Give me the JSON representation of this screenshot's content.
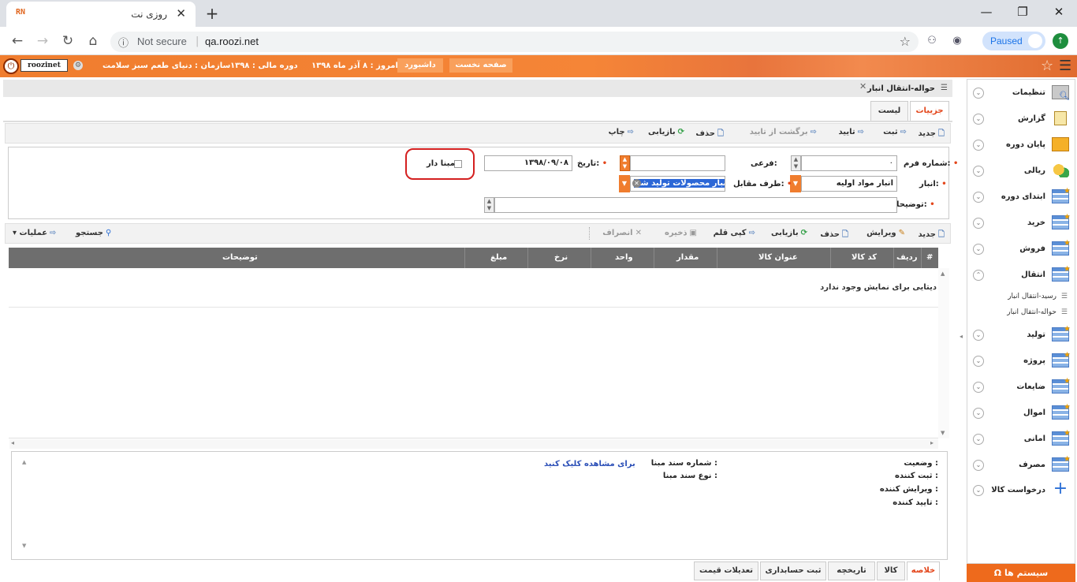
{
  "browser": {
    "tab_title": "روزی نت",
    "favicon": "RN",
    "new_tab": "+",
    "not_secure": "Not secure",
    "url": "qa.roozi.net",
    "paused": "Paused"
  },
  "header": {
    "user": "roozinet",
    "org": "سازمان : دنیای طعم سبز سلامت",
    "fiscal_year": "دوره مالی : ۱۳۹۸",
    "today": "امروز : ۸ آذر ماه ۱۳۹۸",
    "dashboard": "داشبورد",
    "home": "صفحه نخست"
  },
  "sidebar": {
    "items": [
      {
        "label": "تنظیمات"
      },
      {
        "label": "گزارش"
      },
      {
        "label": "پایان دوره"
      },
      {
        "label": "ریالی"
      },
      {
        "label": "ابتدای دوره"
      },
      {
        "label": "خرید"
      },
      {
        "label": "فروش"
      },
      {
        "label": "انتقال"
      },
      {
        "label": "تولید"
      },
      {
        "label": "پروژه"
      },
      {
        "label": "ضایعات"
      },
      {
        "label": "اموال"
      },
      {
        "label": "امانی"
      },
      {
        "label": "مصرف"
      },
      {
        "label": "درخواست کالا"
      }
    ],
    "subitems": [
      {
        "label": "رسید-انتقال انبار"
      },
      {
        "label": "حواله-انتقال انبار"
      }
    ],
    "system_button": "سیستم ها"
  },
  "panel": {
    "title": "حواله-انتقال انبار",
    "tabs": {
      "details": "جزییات",
      "list": "لیست"
    }
  },
  "toolbar": {
    "new": "جدید",
    "register": "ثبت",
    "approve": "تایید",
    "unapprove": "برگشت از تایید",
    "delete": "حذف",
    "refresh": "بازیابی",
    "print": "چاپ"
  },
  "form": {
    "form_number_label": "شماره فرم:",
    "form_number_value": "۰",
    "sub_label": "فرعی:",
    "sub_value": "",
    "date_label": "تاریخ:",
    "date_value": "۱۳۹۸/۰۹/۰۸",
    "warehouse_label": "انبار:",
    "warehouse_value": "انبار مواد اولیه",
    "counterparty_label": "طرف مقابل:",
    "counterparty_value": "انبار محصولات تولید شد",
    "description_label": "توضیحات:",
    "base_label": "مبنا دار"
  },
  "grid_toolbar": {
    "new": "جدید",
    "edit": "ویرایش",
    "delete": "حذف",
    "refresh": "بازیابی",
    "copy": "کپی قلم",
    "save": "ذخیره",
    "cancel": "انصراف",
    "search": "جستجو",
    "operations": "عملیات"
  },
  "grid": {
    "columns": [
      "#",
      "ردیف",
      "کد کالا",
      "عنوان کالا",
      "مقدار",
      "واحد",
      "نرخ",
      "مبلغ",
      "توضیحات"
    ],
    "empty_text": "دیتایی برای نمایش وجود ندارد"
  },
  "summary": {
    "status": "وضعیت :",
    "registrar": "ثبت کننده :",
    "editor": "ویرایش کننده :",
    "approver": "تایید کننده :",
    "base_doc_number": "شماره سند مبنا :",
    "base_doc_type": "نوع سند مبنا :",
    "view_link": "برای مشاهده کلیک کنید"
  },
  "bottom_tabs": [
    "خلاصه",
    "کالا",
    "تاریخچه",
    "ثبت حسابداری",
    "تعدیلات قیمت"
  ]
}
